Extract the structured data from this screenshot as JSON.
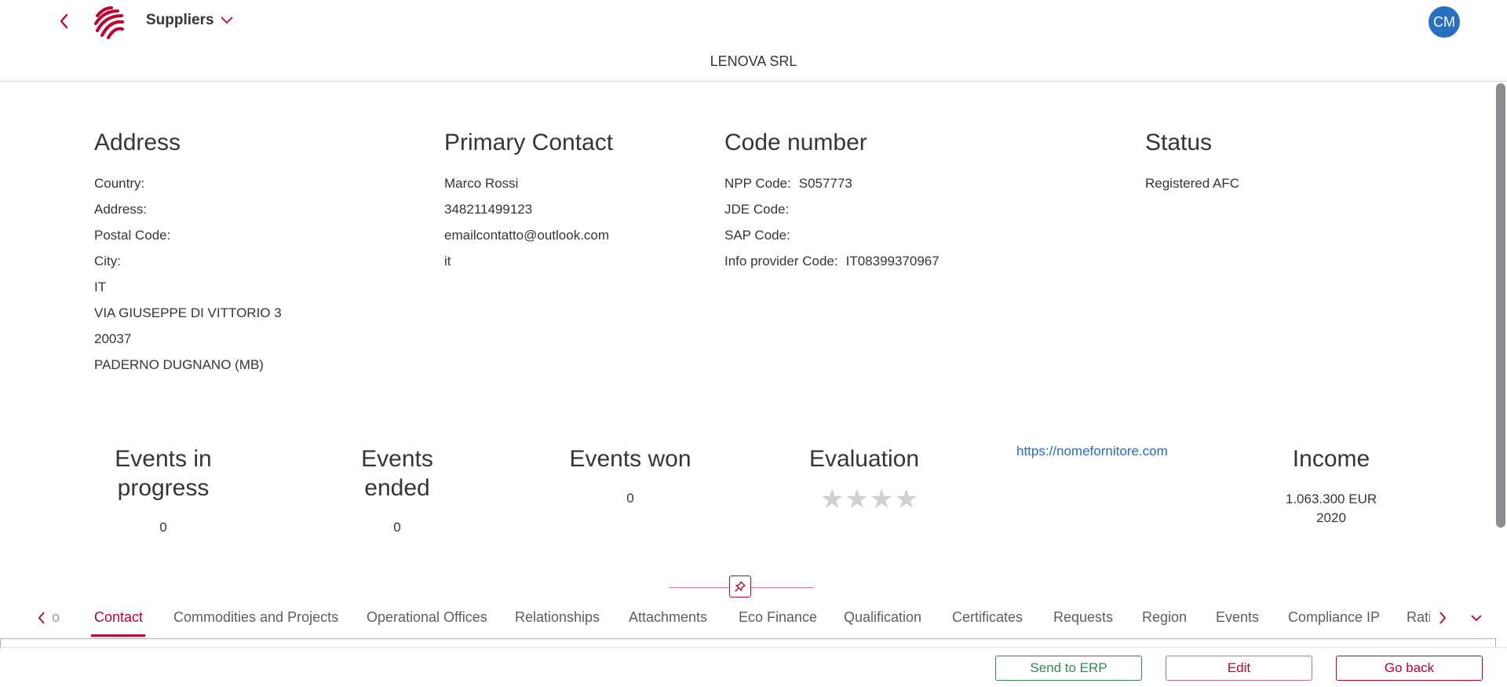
{
  "header": {
    "app_title": "Suppliers",
    "object_title": "LENOVA SRL",
    "avatar_initials": "CM"
  },
  "address": {
    "heading": "Address",
    "labels": [
      "Country:",
      "Address:",
      "Postal Code:",
      "City:"
    ],
    "values": [
      "IT",
      "VIA GIUSEPPE DI VITTORIO 3",
      "20037",
      "PADERNO DUGNANO (MB)"
    ]
  },
  "primary_contact": {
    "heading": "Primary Contact",
    "lines": [
      "Marco Rossi",
      "348211499123",
      "emailcontatto@outlook.com",
      "it"
    ]
  },
  "code_number": {
    "heading": "Code number",
    "rows": [
      {
        "label": "NPP Code:",
        "value": "S057773"
      },
      {
        "label": "JDE Code:",
        "value": ""
      },
      {
        "label": "SAP Code:",
        "value": ""
      },
      {
        "label": "Info provider Code:",
        "value": "IT08399370967"
      }
    ]
  },
  "status": {
    "heading": "Status",
    "value": "Registered AFC"
  },
  "kpis": {
    "events_in_progress": {
      "title_line1": "Events in",
      "title_line2": "progress",
      "value": "0"
    },
    "events_ended": {
      "title_line1": "Events",
      "title_line2": "ended",
      "value": "0"
    },
    "events_won": {
      "title": "Events won",
      "value": "0"
    },
    "evaluation": {
      "title": "Evaluation",
      "stars_filled": 0,
      "stars_total": 4
    },
    "website": "https://nomefornitore.com",
    "income": {
      "title": "Income",
      "amount": "1.063.300 EUR",
      "year": "2020"
    }
  },
  "tabs": {
    "partial_left": "o",
    "items": [
      "Contact",
      "Commodities and Projects",
      "Operational Offices",
      "Relationships",
      "Attachments",
      "Eco Finance",
      "Qualification",
      "Certificates",
      "Requests",
      "Region",
      "Events",
      "Compliance IP",
      "Rati"
    ],
    "active": "Contact"
  },
  "footer": {
    "send_to_erp": "Send to ERP",
    "edit": "Edit",
    "go_back": "Go back"
  },
  "colors": {
    "accent": "#c0002f",
    "link": "#1a6dd6",
    "avatar": "#2a6fbd",
    "erp_button": "#2e8b57"
  }
}
